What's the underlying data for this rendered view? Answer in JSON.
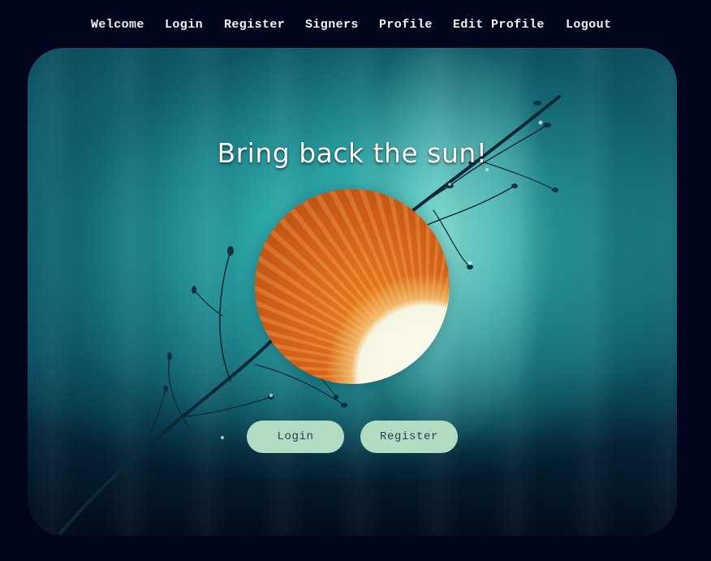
{
  "nav": {
    "items": [
      {
        "label": "Welcome"
      },
      {
        "label": "Login"
      },
      {
        "label": "Register"
      },
      {
        "label": "Signers"
      },
      {
        "label": "Profile"
      },
      {
        "label": "Edit Profile"
      },
      {
        "label": "Logout"
      }
    ]
  },
  "hero": {
    "title": "Bring back the sun!",
    "buttons": {
      "login_label": "Login",
      "register_label": "Register"
    }
  },
  "colors": {
    "page_background": "#01051c",
    "nav_text": "#f2f4f6",
    "button_fill": "#b2dcc2",
    "button_text": "#1d4350",
    "sun_orange": "#dc6b1a"
  }
}
